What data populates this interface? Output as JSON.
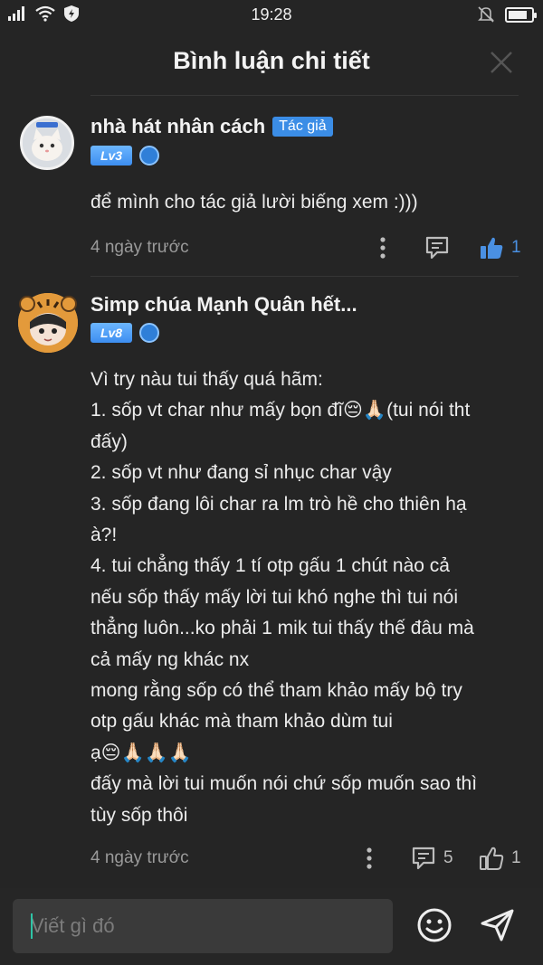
{
  "status_bar": {
    "time": "19:28",
    "battery_level": 0.85
  },
  "header": {
    "title": "Bình luận chi tiết"
  },
  "comments": [
    {
      "author": "nhà hát nhân cách",
      "author_tag": "Tác giả",
      "level": "Lv3",
      "text": "để mình cho tác giả lười biếng xem :)))",
      "time": "4 ngày trước",
      "reply_count": "",
      "like_count": "1",
      "liked": true
    },
    {
      "author": "Simp chúa Mạnh Quân hết...",
      "level": "Lv8",
      "lines": [
        "Vì try nàu tui thấy quá hãm:",
        "1. sốp vt char như mấy bọn đĩ😔🙏🏻(tui nói tht",
        "đấy)",
        "2. sốp vt như đang sỉ nhục char vậy",
        "3. sốp đang lôi char ra lm trò hề cho thiên hạ",
        "à?!",
        "4. tui chẳng thấy 1 tí otp gấu 1 chút nào cả",
        "nếu sốp thấy mấy lời tui khó nghe thì tui nói",
        "thẳng luôn...ko phải 1 mik tui thấy thế đâu mà",
        "cả mấy ng khác nx",
        "mong rằng sốp có thể tham khảo mấy bộ try",
        "otp gấu khác mà tham khảo dùm tui",
        "ạ😔🙏🏻🙏🏻🙏🏻",
        "đấy mà lời tui muốn nói chứ sốp muốn sao thì",
        "tùy sốp thôi"
      ],
      "time": "4 ngày trước",
      "reply_count": "5",
      "like_count": "1",
      "liked": false
    }
  ],
  "input": {
    "placeholder": "Viết gì đó"
  },
  "colors": {
    "background": "#252525",
    "accent": "#3b8de6",
    "caret": "#2ec4a6"
  }
}
